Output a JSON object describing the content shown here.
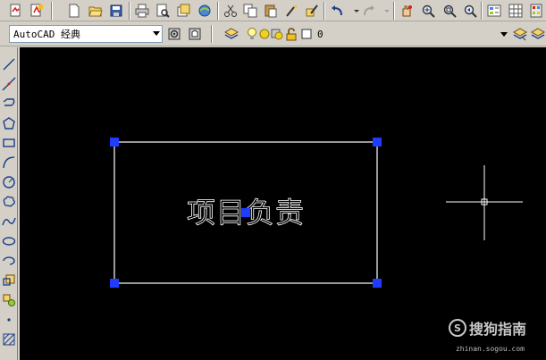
{
  "workspace_dropdown": {
    "value": "AutoCAD 经典"
  },
  "layer_dropdown": {
    "value": "0"
  },
  "drawing": {
    "mtext": "项目负责",
    "colors": {
      "rectangle": "#ffffff",
      "grip": "#1f3cff",
      "crosshair": "#ffffff",
      "background": "#000000"
    }
  },
  "watermark": {
    "logo_letter": "S",
    "text": "搜狗指南",
    "url": "zhinan.sogou.com"
  },
  "icons": {
    "top_toolbar": [
      "pdf-import-icon",
      "pdf-export-icon",
      "new-file-icon",
      "open-file-icon",
      "save-icon",
      "print-icon",
      "print-preview-icon",
      "publish-icon",
      "3d-publish-icon",
      "cut-icon",
      "copy-icon",
      "paste-icon",
      "match-properties-icon",
      "block-editor-icon",
      "undo-icon",
      "redo-icon",
      "pan-icon",
      "zoom-realtime-icon",
      "zoom-window-icon",
      "zoom-previous-icon",
      "properties-icon",
      "design-center-icon",
      "tool-palettes-icon"
    ],
    "left_toolbar": [
      "line-icon",
      "construction-line-icon",
      "polyline-icon",
      "polygon-icon",
      "rectangle-icon",
      "arc-icon",
      "circle-icon",
      "revision-cloud-icon",
      "spline-icon",
      "ellipse-icon",
      "ellipse-arc-icon",
      "insert-block-icon",
      "make-block-icon",
      "point-icon",
      "hatch-icon"
    ]
  }
}
